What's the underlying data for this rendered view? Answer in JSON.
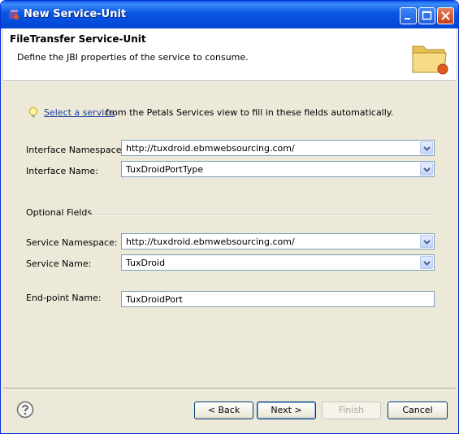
{
  "window": {
    "title": "New Service-Unit"
  },
  "header": {
    "title": "FileTransfer Service-Unit",
    "description": "Define the JBI properties of the service to consume."
  },
  "hint": {
    "link": "Select a service",
    "rest": " from the Petals Services view to fill in these fields automatically."
  },
  "form": {
    "interface_namespace": {
      "label": "Interface Namespace:",
      "value": "http://tuxdroid.ebmwebsourcing.com/"
    },
    "interface_name": {
      "label": "Interface Name:",
      "value": "TuxDroidPortType"
    },
    "optional_group": "Optional Fields",
    "service_namespace": {
      "label": "Service Namespace:",
      "value": "http://tuxdroid.ebmwebsourcing.com/"
    },
    "service_name": {
      "label": "Service Name:",
      "value": "TuxDroid"
    },
    "endpoint_name": {
      "label": "End-point Name:",
      "value": "TuxDroidPort"
    }
  },
  "buttons": {
    "back": "< Back",
    "next": "Next >",
    "finish": "Finish",
    "cancel": "Cancel"
  }
}
